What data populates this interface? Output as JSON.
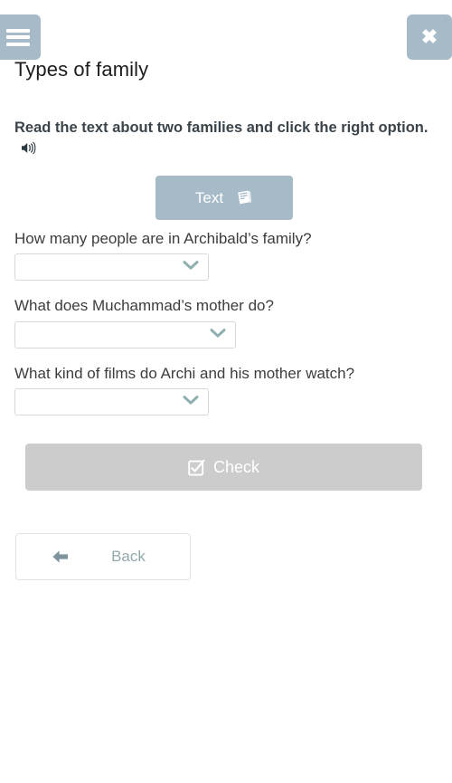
{
  "header": {
    "menu_button": "menu",
    "menu_icon": "hamburger-menu-icon",
    "close_button": "close",
    "close_icon": "close-x-icon",
    "close_glyph": "✖",
    "title": "Types of family"
  },
  "instruction": {
    "text": "Read the text about two families and click the right option.",
    "audio_icon": "speaker-icon"
  },
  "text_button": {
    "label": "Text",
    "icon": "book-icon"
  },
  "questions": [
    {
      "label": "How many people are in Archibald’s family?",
      "selected_value": "",
      "width": "w1",
      "chevron_icon": "chevron-down-icon"
    },
    {
      "label": "What does Muchammad’s mother do?",
      "selected_value": "",
      "width": "w2",
      "chevron_icon": "chevron-down-icon"
    },
    {
      "label": "What kind of films do Archi and his mother watch?",
      "selected_value": "",
      "width": "w1",
      "chevron_icon": "chevron-down-icon"
    }
  ],
  "check_button": {
    "label": "Check",
    "icon": "checkbox-checked-icon",
    "state": "disabled"
  },
  "back_button": {
    "label": "Back",
    "icon": "arrow-left-icon"
  },
  "colors": {
    "accent_blue_gray": "#a6bbc7",
    "disabled_gray": "#cccccc",
    "chevron_teal": "#8fb0ae",
    "text_dark": "#3b444a",
    "back_text": "#93a8ab",
    "back_arrow": "#7e949c",
    "border_light": "#e2e2e2",
    "background": "#ffffff"
  }
}
